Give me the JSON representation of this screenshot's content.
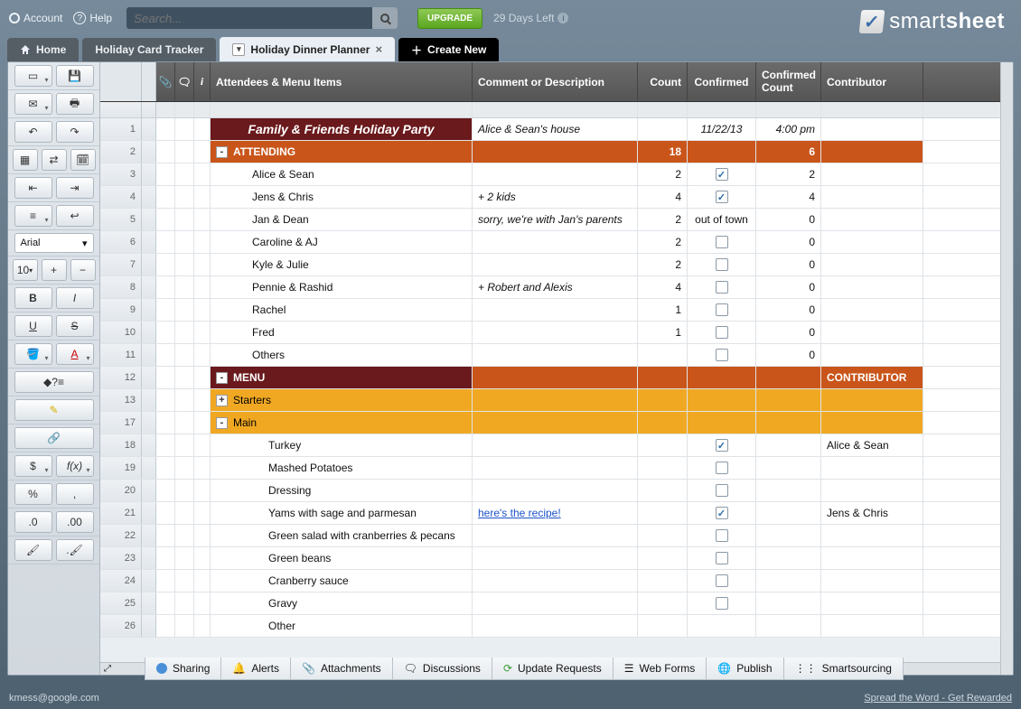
{
  "top": {
    "account": "Account",
    "help": "Help",
    "search_placeholder": "Search...",
    "upgrade": "UPGRADE",
    "trial": "29 Days Left",
    "brand1": "smart",
    "brand2": "sheet"
  },
  "tabs": {
    "home": "Home",
    "t1": "Holiday Card Tracker",
    "t2": "Holiday Dinner Planner",
    "new": "Create New"
  },
  "fontName": "Arial",
  "fontSize": "10",
  "cols": {
    "primary": "Attendees & Menu Items",
    "comment": "Comment or Description",
    "count": "Count",
    "conf": "Confirmed",
    "confcnt": "Confirmed Count",
    "contrib": "Contributor"
  },
  "rows": [
    {
      "n": "1",
      "type": "title",
      "primary": "Family & Friends Holiday Party",
      "comment": "Alice & Sean's house",
      "conf": "11/22/13",
      "confcnt": "4:00 pm"
    },
    {
      "n": "2",
      "type": "hdr",
      "collapse": "-",
      "primary": "ATTENDING",
      "count": "18",
      "confcnt": "6"
    },
    {
      "n": "3",
      "type": "d",
      "indent": 2,
      "primary": "Alice & Sean",
      "count": "2",
      "cb": true,
      "checked": true,
      "confcnt": "2"
    },
    {
      "n": "4",
      "type": "d",
      "indent": 2,
      "primary": "Jens & Chris",
      "comment": "+ 2 kids",
      "count": "4",
      "cb": true,
      "checked": true,
      "confcnt": "4"
    },
    {
      "n": "5",
      "type": "d",
      "indent": 2,
      "primary": "Jan & Dean",
      "comment": "sorry, we're with Jan's parents",
      "count": "2",
      "conf": "out of town",
      "confcnt": "0"
    },
    {
      "n": "6",
      "type": "d",
      "indent": 2,
      "primary": "Caroline & AJ",
      "count": "2",
      "cb": true,
      "confcnt": "0"
    },
    {
      "n": "7",
      "type": "d",
      "indent": 2,
      "primary": "Kyle & Julie",
      "count": "2",
      "cb": true,
      "confcnt": "0"
    },
    {
      "n": "8",
      "type": "d",
      "indent": 2,
      "primary": "Pennie & Rashid",
      "comment": "+ Robert and Alexis",
      "count": "4",
      "cb": true,
      "confcnt": "0"
    },
    {
      "n": "9",
      "type": "d",
      "indent": 2,
      "primary": "Rachel",
      "count": "1",
      "cb": true,
      "confcnt": "0"
    },
    {
      "n": "10",
      "type": "d",
      "indent": 2,
      "primary": "Fred",
      "count": "1",
      "cb": true,
      "confcnt": "0"
    },
    {
      "n": "11",
      "type": "d",
      "indent": 2,
      "primary": "Others",
      "cb": true,
      "confcnt": "0"
    },
    {
      "n": "12",
      "type": "hdr",
      "dark": true,
      "collapse": "-",
      "primary": "MENU",
      "contrib": "CONTRIBUTOR"
    },
    {
      "n": "13",
      "type": "sub",
      "collapse": "+",
      "primary": "Starters"
    },
    {
      "n": "17",
      "type": "sub",
      "collapse": "-",
      "primary": "Main"
    },
    {
      "n": "18",
      "type": "d",
      "indent": 3,
      "primary": "Turkey",
      "cb": true,
      "checked": true,
      "contrib": "Alice & Sean"
    },
    {
      "n": "19",
      "type": "d",
      "indent": 3,
      "primary": "Mashed Potatoes",
      "cb": true
    },
    {
      "n": "20",
      "type": "d",
      "indent": 3,
      "primary": "Dressing",
      "cb": true
    },
    {
      "n": "21",
      "type": "d",
      "indent": 3,
      "primary": "Yams with sage and parmesan",
      "comment": "here's the recipe!",
      "link": true,
      "cb": true,
      "checked": true,
      "contrib": "Jens & Chris"
    },
    {
      "n": "22",
      "type": "d",
      "indent": 3,
      "primary": "Green salad with cranberries & pecans",
      "cb": true
    },
    {
      "n": "23",
      "type": "d",
      "indent": 3,
      "primary": "Green beans",
      "cb": true
    },
    {
      "n": "24",
      "type": "d",
      "indent": 3,
      "primary": "Cranberry sauce",
      "cb": true
    },
    {
      "n": "25",
      "type": "d",
      "indent": 3,
      "primary": "Gravy",
      "cb": true
    },
    {
      "n": "26",
      "type": "d",
      "indent": 3,
      "primary": "Other"
    }
  ],
  "footer": {
    "sharing": "Sharing",
    "alerts": "Alerts",
    "attach": "Attachments",
    "disc": "Discussions",
    "upd": "Update Requests",
    "web": "Web Forms",
    "pub": "Publish",
    "smart": "Smartsourcing"
  },
  "bottom": {
    "email": "kmess@google.com",
    "spread": "Spread the Word - Get Rewarded"
  }
}
